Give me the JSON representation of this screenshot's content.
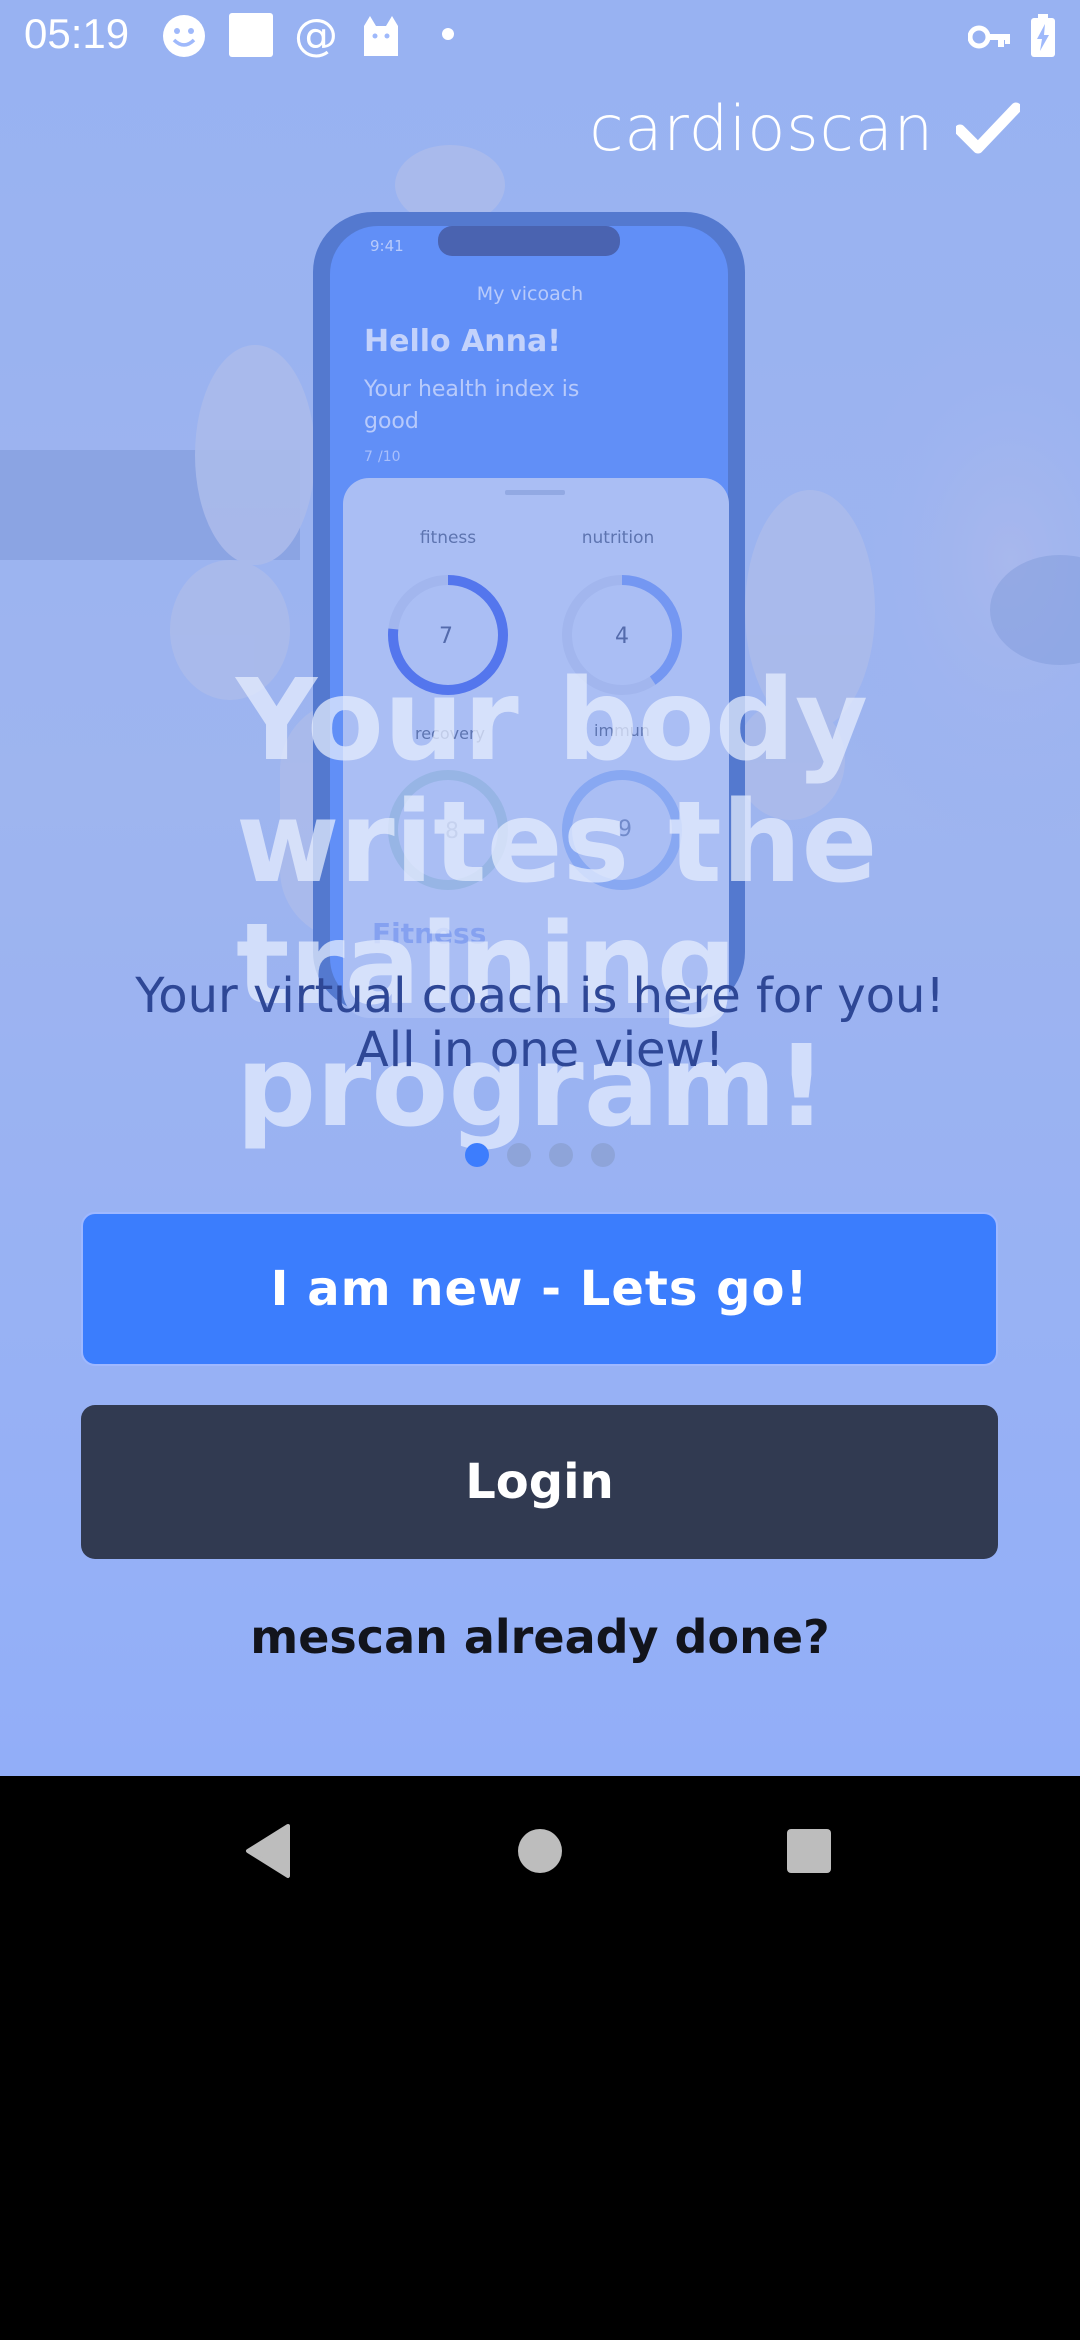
{
  "status_bar": {
    "time": "05:19",
    "icons": [
      "smiley-icon",
      "square-icon",
      "at-icon",
      "cat-icon",
      "dot-icon",
      "key-icon",
      "battery-charging-icon"
    ]
  },
  "brand": {
    "name": "cardioscan",
    "mark_icon": "checkmark-icon"
  },
  "hero": {
    "headline": "Your body writes the training program!",
    "subline_1": "Your virtual coach is here for you!",
    "subline_2": "All in one view!",
    "pager": {
      "total": 4,
      "active": 1
    }
  },
  "phone_mockup": {
    "time": "9:41",
    "header": "My vicoach",
    "greeting": "Hello Anna!",
    "health_text": "Your health index is good",
    "index": "7",
    "index_suffix": "/10",
    "metrics": [
      {
        "label": "fitness",
        "value": "7"
      },
      {
        "label": "nutrition",
        "value": "4"
      },
      {
        "label": "recovery",
        "value": "8"
      },
      {
        "label": "immun",
        "value": "9"
      }
    ],
    "section": "Fitness"
  },
  "actions": {
    "new_user": "I am new - Lets go!",
    "login": "Login",
    "already_done": "mescan already done?"
  },
  "colors": {
    "primary": "#3b7dfd",
    "dark": "#313a51",
    "overlay": "#9fb9fb"
  },
  "nav": {
    "icons": [
      "back-icon",
      "home-icon",
      "recents-icon"
    ]
  }
}
